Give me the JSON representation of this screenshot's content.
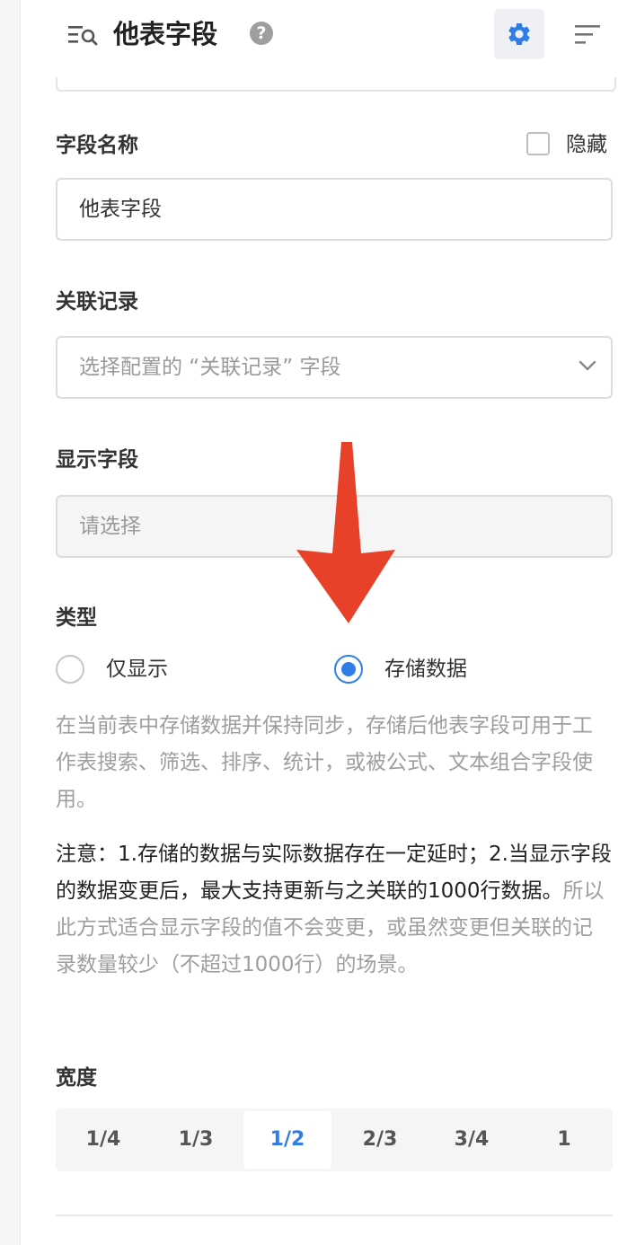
{
  "header": {
    "title": "他表字段",
    "help_symbol": "?",
    "icons": [
      "list-search-icon",
      "help-icon",
      "gear-icon",
      "sort-icon"
    ]
  },
  "field_name": {
    "label": "字段名称",
    "hide_label": "隐藏",
    "hide_checked": false,
    "value": "他表字段"
  },
  "related_record": {
    "label": "关联记录",
    "placeholder": "选择配置的 “关联记录” 字段"
  },
  "display_field": {
    "label": "显示字段",
    "placeholder": "请选择"
  },
  "type": {
    "label": "类型",
    "options": [
      {
        "label": "仅显示",
        "selected": false
      },
      {
        "label": "存储数据",
        "selected": true
      }
    ],
    "description": "在当前表中存储数据并保持同步，存储后他表字段可用于工作表搜索、筛选、排序、统计，或被公式、文本组合字段使用。",
    "note_emphasis": "注意：1.存储的数据与实际数据存在一定延时；2.当显示字段的数据变更后，最大支持更新与之关联的1000行数据。",
    "note_rest": "所以此方式适合显示字段的值不会变更，或虽然变更但关联的记录数量较少（不超过1000行）的场景。"
  },
  "width": {
    "label": "宽度",
    "options": [
      "1/4",
      "1/3",
      "1/2",
      "2/3",
      "3/4",
      "1"
    ],
    "selected": "1/2"
  },
  "colors": {
    "accent": "#2f7ee8",
    "annotation_arrow": "#e8412a"
  }
}
